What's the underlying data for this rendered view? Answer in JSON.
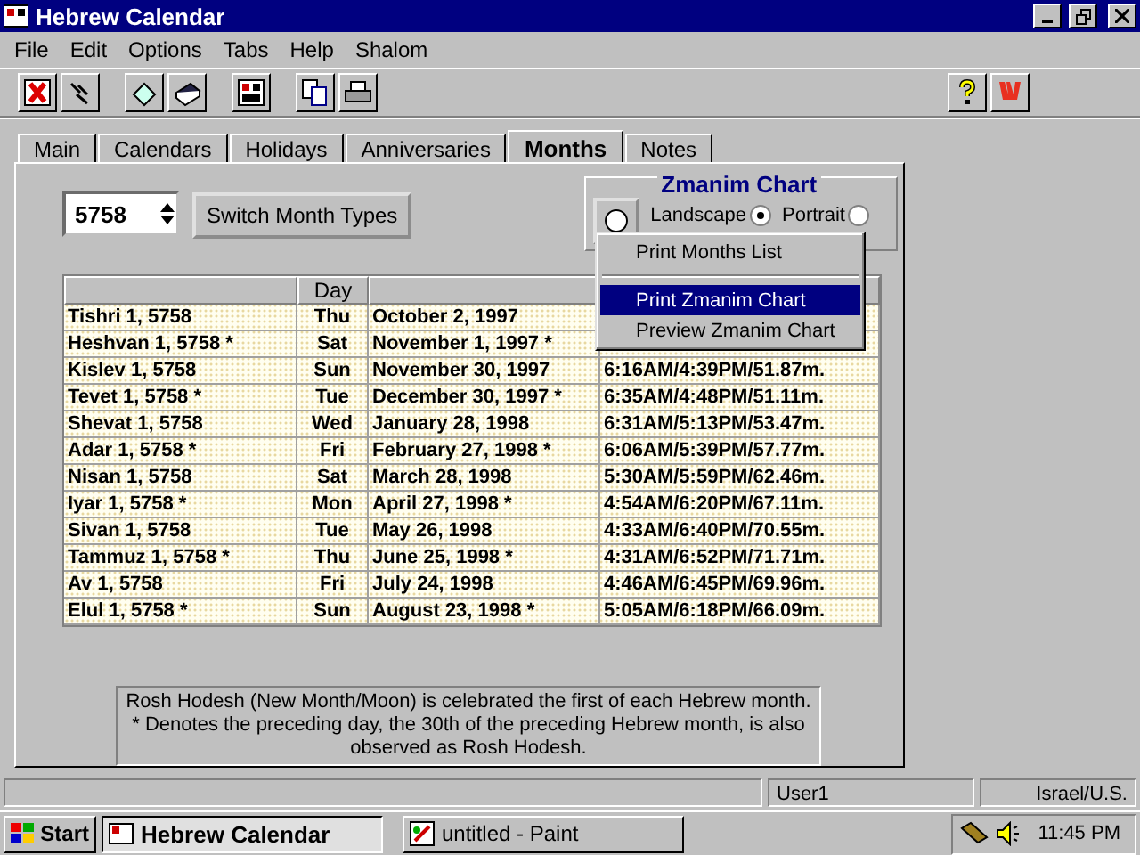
{
  "window": {
    "title": "Hebrew Calendar"
  },
  "menu_bar": [
    "File",
    "Edit",
    "Options",
    "Tabs",
    "Help",
    "Shalom"
  ],
  "tabs": [
    {
      "label": "Main",
      "selected": false
    },
    {
      "label": "Calendars",
      "selected": false
    },
    {
      "label": "Holidays",
      "selected": false
    },
    {
      "label": "Anniversaries",
      "selected": false
    },
    {
      "label": "Months",
      "selected": true
    },
    {
      "label": "Notes",
      "selected": false
    }
  ],
  "year_spinner": {
    "value": "5758"
  },
  "switch_button": "Switch Month Types",
  "zmanim_chart": {
    "title": "Zmanim Chart",
    "orientation": [
      {
        "label": "Landscape",
        "selected": true
      },
      {
        "label": "Portrait",
        "selected": false
      }
    ]
  },
  "context_menu": [
    {
      "kind": "item",
      "label": "Print Months List",
      "selected": false
    },
    {
      "kind": "separator"
    },
    {
      "kind": "item",
      "label": "Print Zmanim Chart",
      "selected": true
    },
    {
      "kind": "item",
      "label": "Preview Zmanim Chart",
      "selected": false
    }
  ],
  "table": {
    "header": {
      "column_2": "Day"
    },
    "rows": [
      {
        "hebrew_date": "Tishri 1, 5758",
        "day": "Thu",
        "date": "October 2, 1997"
      },
      {
        "hebrew_date": "Heshvan 1, 5758 *",
        "day": "Sat",
        "date": "November 1, 1997 *"
      },
      {
        "hebrew_date": "Kislev 1, 5758",
        "day": "Sun",
        "date": "November 30, 1997",
        "times": "6:16AM/4:39PM/51.87m."
      },
      {
        "hebrew_date": "Tevet 1, 5758 *",
        "day": "Tue",
        "date": "December 30, 1997 *",
        "times": "6:35AM/4:48PM/51.11m."
      },
      {
        "hebrew_date": "Shevat 1, 5758",
        "day": "Wed",
        "date": "January 28, 1998",
        "times": "6:31AM/5:13PM/53.47m."
      },
      {
        "hebrew_date": "Adar 1, 5758 *",
        "day": "Fri",
        "date": "February 27, 1998 *",
        "times": "6:06AM/5:39PM/57.77m."
      },
      {
        "hebrew_date": "Nisan 1, 5758",
        "day": "Sat",
        "date": "March 28, 1998",
        "times": "5:30AM/5:59PM/62.46m."
      },
      {
        "hebrew_date": "Iyar 1, 5758 *",
        "day": "Mon",
        "date": "April 27, 1998 *",
        "times": "4:54AM/6:20PM/67.11m."
      },
      {
        "hebrew_date": "Sivan 1, 5758",
        "day": "Tue",
        "date": "May 26, 1998",
        "times": "4:33AM/6:40PM/70.55m."
      },
      {
        "hebrew_date": "Tammuz 1, 5758 *",
        "day": "Thu",
        "date": "June 25, 1998 *",
        "times": "4:31AM/6:52PM/71.71m."
      },
      {
        "hebrew_date": "Av 1, 5758",
        "day": "Fri",
        "date": "July 24, 1998",
        "times": "4:46AM/6:45PM/69.96m."
      },
      {
        "hebrew_date": "Elul 1, 5758 *",
        "day": "Sun",
        "date": "August 23, 1998 *",
        "times": "5:05AM/6:18PM/66.09m."
      }
    ]
  },
  "note": [
    "Rosh Hodesh (New Month/Moon) is celebrated the first of each Hebrew month.",
    "* Denotes the preceding day, the 30th of the preceding Hebrew month, is also observed as Rosh Hodesh."
  ],
  "status_bar": {
    "panels": [
      "User1",
      "Israel/U.S."
    ]
  },
  "taskbar": {
    "start": "Start",
    "tasks": [
      {
        "label": "Hebrew Calendar",
        "selected": true
      },
      {
        "label": "untitled - Paint",
        "selected": false
      }
    ],
    "clock": "11:45 PM"
  }
}
